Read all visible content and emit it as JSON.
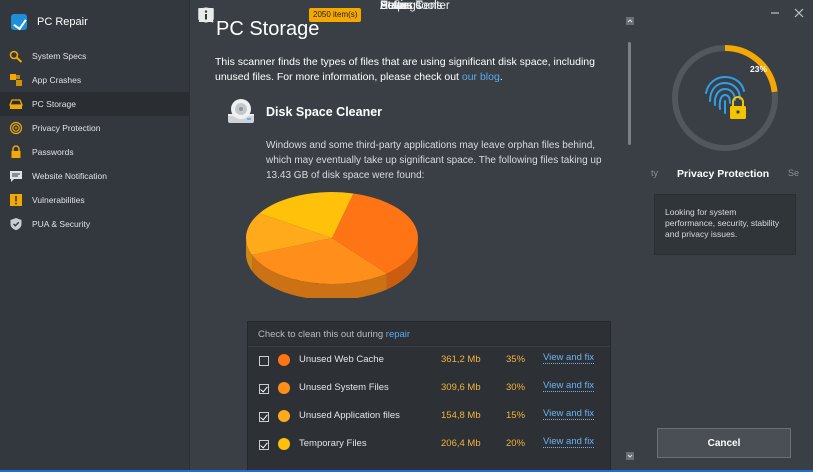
{
  "app": {
    "title": "PC Repair"
  },
  "sidebar": {
    "main_top": [
      {
        "label": "Action Center",
        "icon": "grid-icon"
      },
      {
        "label": "Status",
        "icon": "monitor-icon"
      },
      {
        "label": "Scan",
        "icon": "search-icon",
        "badge": "2050 item(s)"
      }
    ],
    "sub_items": [
      {
        "label": "System Specs",
        "icon": "gear-wrench-icon"
      },
      {
        "label": "App Crashes",
        "icon": "crash-icon"
      },
      {
        "label": "PC Storage",
        "icon": "drive-icon",
        "active": true
      },
      {
        "label": "Privacy Protection",
        "icon": "fingerprint-icon"
      },
      {
        "label": "Passwords",
        "icon": "lock-icon"
      },
      {
        "label": "Website Notification",
        "icon": "chat-icon"
      },
      {
        "label": "Vulnerabilities",
        "icon": "warning-icon"
      },
      {
        "label": "PUA & Security",
        "icon": "shield-icon"
      }
    ],
    "main_bottom": [
      {
        "label": "Power Tools",
        "icon": "toolbox-icon"
      },
      {
        "label": "Settings",
        "icon": "gear-icon"
      },
      {
        "label": "Help",
        "icon": "info-icon"
      }
    ]
  },
  "main": {
    "title": "PC Storage",
    "intro_text": "This scanner finds the types of files that are using significant disk space, including unused files. For more information, please check out ",
    "intro_link": "our blog",
    "intro_end": ".",
    "section_title": "Disk Space Cleaner",
    "description": "Windows and some third-party applications may leave orphan files behind, which may eventually take up significant space. The following files taking up 13.43 GB of disk space were found:",
    "chart": {
      "type": "pie",
      "slices": [
        {
          "name": "Unused Web Cache",
          "value": 35,
          "color": "#ff7414"
        },
        {
          "name": "Unused System Files",
          "value": 30,
          "color": "#ff8f1a"
        },
        {
          "name": "Unused Application files",
          "value": 15,
          "color": "#ffaa1a"
        },
        {
          "name": "Temporary Files",
          "value": 20,
          "color": "#ffc10a"
        }
      ]
    },
    "files_header_text": "Check to clean this out during ",
    "files_header_link": "repair",
    "files": [
      {
        "name": "Unused Web Cache",
        "size": "361,2 Mb",
        "percent": "35%",
        "action": "View and fix",
        "checked": false,
        "color": "#ff7414"
      },
      {
        "name": "Unused System Files",
        "size": "309,6 Mb",
        "percent": "30%",
        "action": "View and fix",
        "checked": true,
        "color": "#ff8f1a"
      },
      {
        "name": "Unused Application files",
        "size": "154,8 Mb",
        "percent": "15%",
        "action": "View and fix",
        "checked": true,
        "color": "#ffaa1a"
      },
      {
        "name": "Temporary Files",
        "size": "206,4 Mb",
        "percent": "20%",
        "action": "View and fix",
        "checked": true,
        "color": "#ffc10a"
      }
    ]
  },
  "right": {
    "gauge_percent": "23%",
    "gauge_value": 0.23,
    "carousel_prev": "ty",
    "carousel_title": "Privacy Protection",
    "carousel_next": "Se",
    "info_text": "Looking for system performance, security, stability and privacy issues.",
    "cancel_label": "Cancel",
    "accent": "#f5a800"
  }
}
